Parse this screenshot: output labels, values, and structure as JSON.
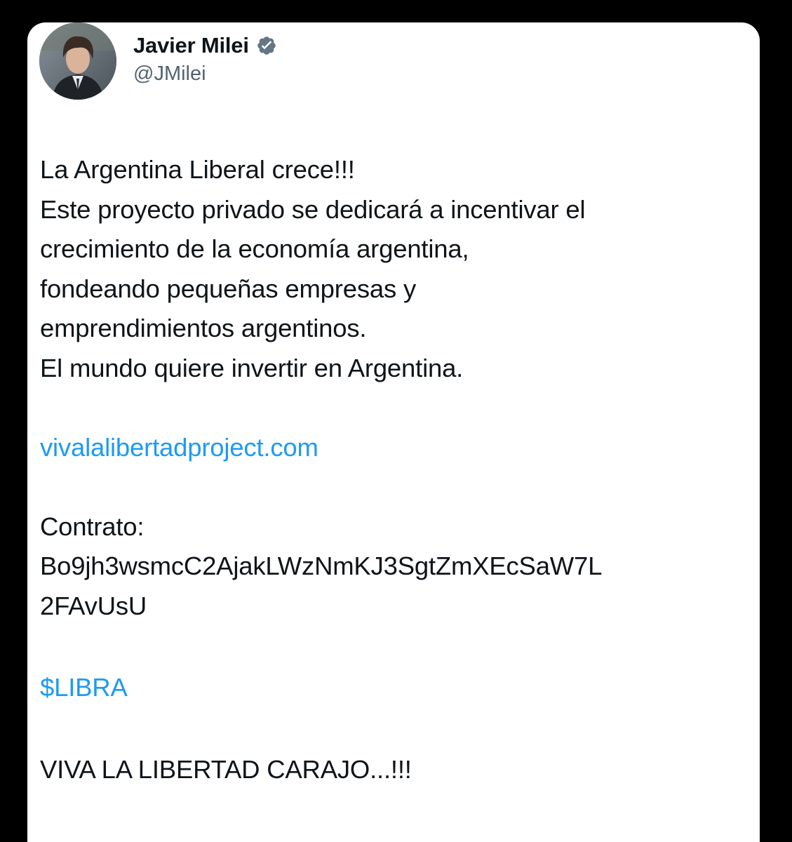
{
  "author": {
    "display_name": "Javier Milei",
    "handle": "@JMilei",
    "verified_icon": "verified-badge-icon",
    "verified_color": "#657786"
  },
  "tweet": {
    "lines": [
      "La Argentina Liberal crece!!!",
      "Este proyecto privado se dedicará a incentivar el",
      "crecimiento de la economía argentina,",
      "fondeando pequeñas empresas y",
      "emprendimientos argentinos.",
      "El mundo quiere invertir en Argentina."
    ],
    "link": "vivalalibertadproject.com",
    "contract_label": "Contrato:",
    "contract_line_1": "Bo9jh3wsmcC2AjakLWzNmKJ3SgtZmXEcSaW7L",
    "contract_line_2": "2FAvUsU",
    "cashtag": "$LIBRA",
    "closing": "VIVA LA LIBERTAD CARAJO...!!!"
  },
  "colors": {
    "background": "#000000",
    "card": "#ffffff",
    "text": "#0f1419",
    "secondary_text": "#536471",
    "link": "#1d9bf0"
  }
}
